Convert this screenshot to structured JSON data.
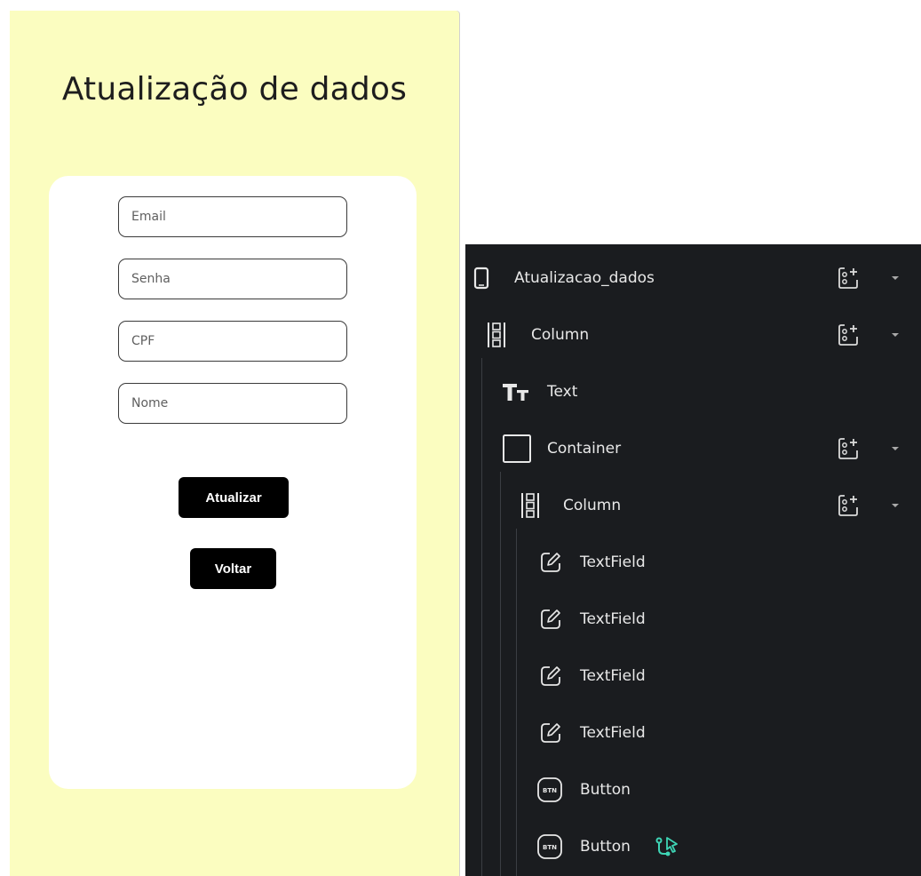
{
  "preview": {
    "title": "Atualização de dados",
    "fields": [
      {
        "placeholder": "Email",
        "value": ""
      },
      {
        "placeholder": "Senha",
        "value": ""
      },
      {
        "placeholder": "CPF",
        "value": ""
      },
      {
        "placeholder": "Nome",
        "value": ""
      }
    ],
    "buttons": {
      "update_label": "Atualizar",
      "back_label": "Voltar"
    },
    "colors": {
      "background": "#fbfdc0",
      "card": "#ffffff",
      "button": "#000000"
    }
  },
  "widget_tree": {
    "colors": {
      "background": "#1a1c1f",
      "text": "#e8e8e8",
      "action_accent": "#3ed5b5"
    },
    "nodes": [
      {
        "label": "Atualizacao_dados",
        "icon": "phone-icon",
        "has_add": true
      },
      {
        "label": "Column",
        "icon": "column-icon",
        "has_add": true
      },
      {
        "label": "Text",
        "icon": "text-icon",
        "has_add": false
      },
      {
        "label": "Container",
        "icon": "container-icon",
        "has_add": true
      },
      {
        "label": "Column",
        "icon": "column-icon",
        "has_add": true
      },
      {
        "label": "TextField",
        "icon": "textfield-icon",
        "has_add": false
      },
      {
        "label": "TextField",
        "icon": "textfield-icon",
        "has_add": false
      },
      {
        "label": "TextField",
        "icon": "textfield-icon",
        "has_add": false
      },
      {
        "label": "TextField",
        "icon": "textfield-icon",
        "has_add": false
      },
      {
        "label": "Button",
        "icon": "button-icon",
        "has_add": false
      },
      {
        "label": "Button",
        "icon": "button-icon",
        "has_add": false,
        "action_icon": "action-flow-icon"
      }
    ],
    "button_icon_text": "BTN"
  }
}
